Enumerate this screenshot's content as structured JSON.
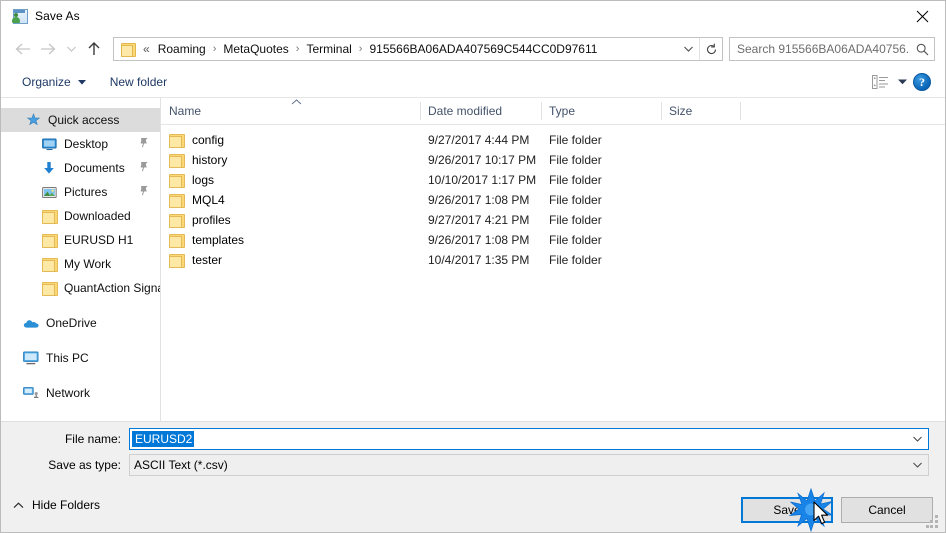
{
  "window": {
    "title": "Save As",
    "app_icon": "save-as-icon",
    "close_label": "✕"
  },
  "nav": {
    "back_icon": "arrow-left-icon",
    "forward_icon": "arrow-right-icon",
    "recent_icon": "chevron-down-icon",
    "up_icon": "arrow-up-icon",
    "refresh_icon": "refresh-icon",
    "address_dropdown_icon": "chevron-down-icon",
    "folder_icon": "folder-icon",
    "overflow": "«",
    "separator": "›",
    "breadcrumbs": [
      "Roaming",
      "MetaQuotes",
      "Terminal",
      "915566BA06ADA407569C544CC0D97611"
    ]
  },
  "search": {
    "placeholder": "Search 915566BA06ADA40756...",
    "icon": "search-icon"
  },
  "toolbar": {
    "organize_label": "Organize",
    "organize_caret": "chevron-down-icon",
    "new_folder_label": "New folder",
    "view_icon": "list-view-icon",
    "view_caret": "chevron-down-icon",
    "help_label": "?"
  },
  "sidebar": {
    "items": [
      {
        "label": "Quick access",
        "icon": "star-pin-icon",
        "level": 0,
        "selected": true,
        "pinned": false
      },
      {
        "label": "Desktop",
        "icon": "desktop-icon",
        "level": 1,
        "selected": false,
        "pinned": true
      },
      {
        "label": "Documents",
        "icon": "documents-download-icon",
        "level": 1,
        "selected": false,
        "pinned": true
      },
      {
        "label": "Pictures",
        "icon": "pictures-icon",
        "level": 1,
        "selected": false,
        "pinned": true
      },
      {
        "label": "Downloaded",
        "icon": "folder-icon",
        "level": 1,
        "selected": false,
        "pinned": false
      },
      {
        "label": "EURUSD H1",
        "icon": "folder-icon",
        "level": 1,
        "selected": false,
        "pinned": false
      },
      {
        "label": "My Work",
        "icon": "folder-icon",
        "level": 1,
        "selected": false,
        "pinned": false
      },
      {
        "label": "QuantAction Signal",
        "icon": "folder-icon",
        "level": 1,
        "selected": false,
        "pinned": false
      },
      {
        "label": "OneDrive",
        "icon": "onedrive-cloud-icon",
        "level": 0,
        "selected": false,
        "pinned": false,
        "group": true
      },
      {
        "label": "This PC",
        "icon": "this-pc-icon",
        "level": 0,
        "selected": false,
        "pinned": false,
        "group": true
      },
      {
        "label": "Network",
        "icon": "network-icon",
        "level": 0,
        "selected": false,
        "pinned": false,
        "group": true
      }
    ]
  },
  "filelist": {
    "columns": [
      "Name",
      "Date modified",
      "Type",
      "Size"
    ],
    "sort_column": "Name",
    "sort_direction": "ascending",
    "rows": [
      {
        "name": "config",
        "date": "9/27/2017 4:44 PM",
        "type": "File folder",
        "size": ""
      },
      {
        "name": "history",
        "date": "9/26/2017 10:17 PM",
        "type": "File folder",
        "size": ""
      },
      {
        "name": "logs",
        "date": "10/10/2017 1:17 PM",
        "type": "File folder",
        "size": ""
      },
      {
        "name": "MQL4",
        "date": "9/26/2017 1:08 PM",
        "type": "File folder",
        "size": ""
      },
      {
        "name": "profiles",
        "date": "9/27/2017 4:21 PM",
        "type": "File folder",
        "size": ""
      },
      {
        "name": "templates",
        "date": "9/26/2017 1:08 PM",
        "type": "File folder",
        "size": ""
      },
      {
        "name": "tester",
        "date": "10/4/2017 1:35 PM",
        "type": "File folder",
        "size": ""
      }
    ]
  },
  "form": {
    "file_name_label": "File name:",
    "file_name_value": "EURUSD2",
    "save_as_type_label": "Save as type:",
    "save_as_type_value": "ASCII Text (*.csv)",
    "dropdown_icon": "chevron-down-icon"
  },
  "footer": {
    "hide_folders_label": "Hide Folders",
    "hide_folders_icon": "chevron-up-icon",
    "save_label": "Save",
    "cancel_label": "Cancel",
    "resize_grip": "resize-grip-icon"
  },
  "colors": {
    "accent": "#0078d7",
    "selection_bg": "#0078d7",
    "sidebar_selected_bg": "#dcdcdc",
    "folder_yellow": "#fbd775",
    "chrome_bg": "#f0f0f0",
    "header_text": "#43536b",
    "toolbar_text": "#1f3864"
  }
}
